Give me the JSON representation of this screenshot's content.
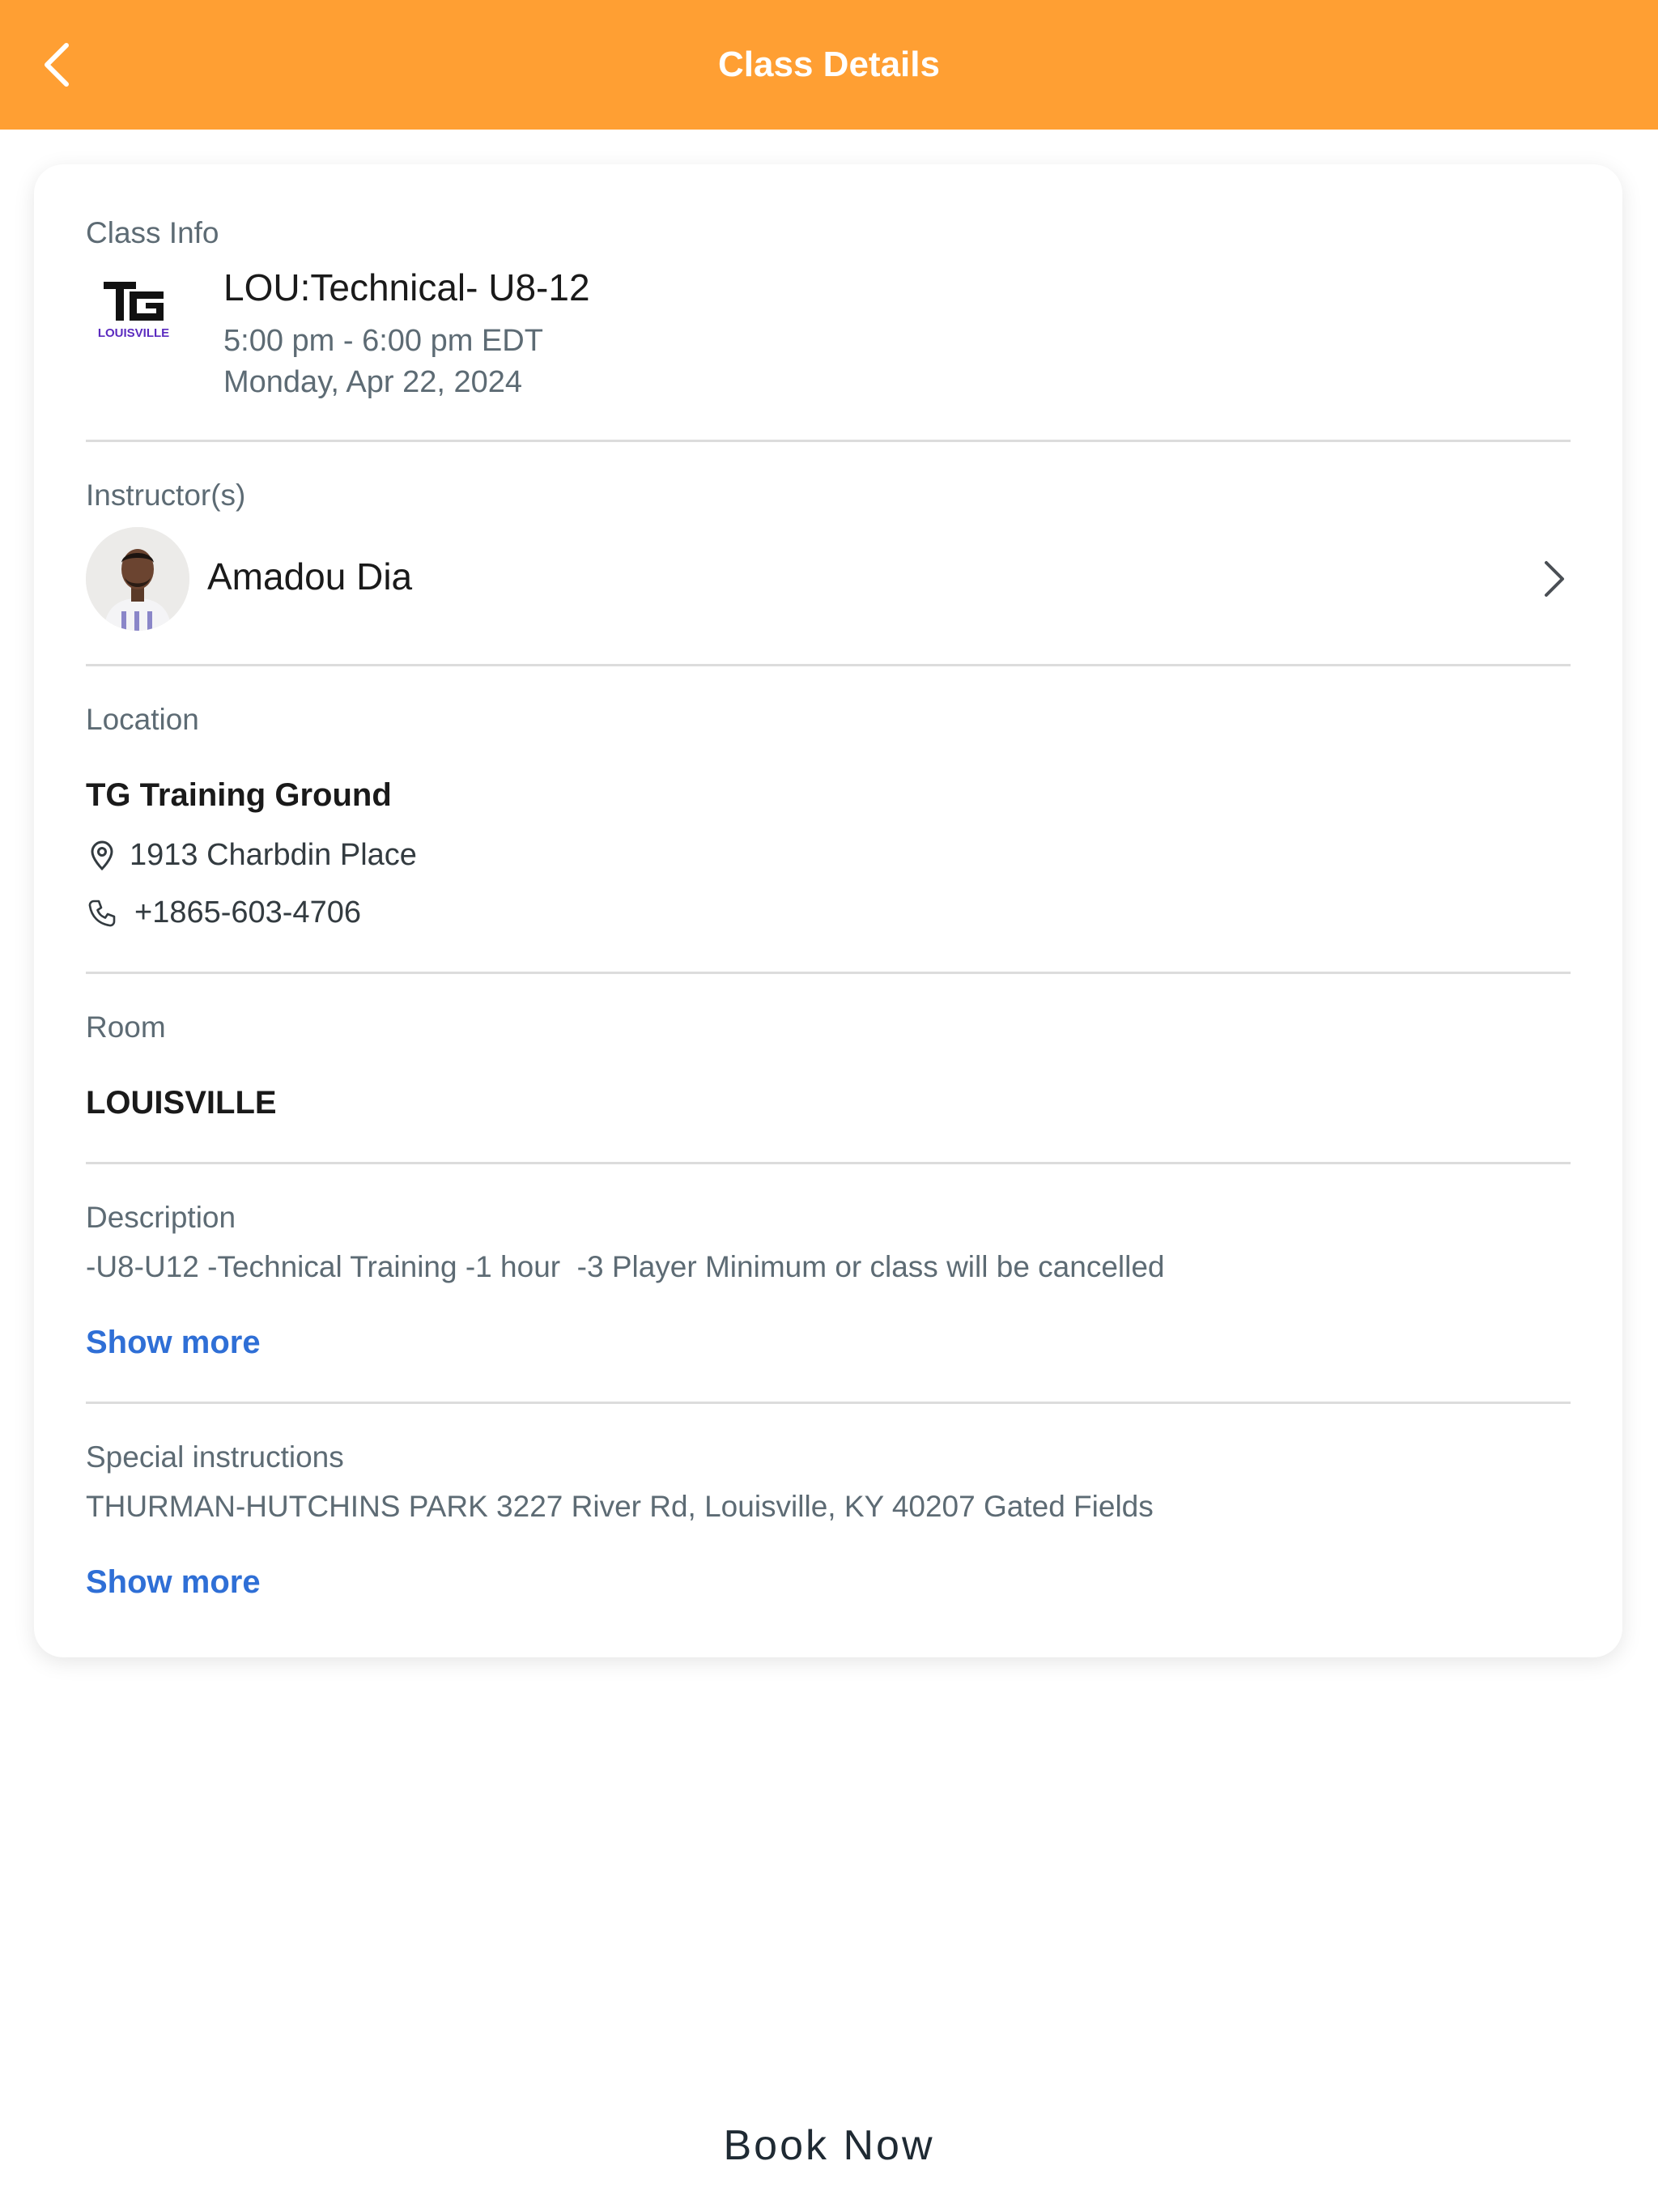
{
  "header": {
    "title": "Class Details",
    "back_icon": "chevron-left-icon",
    "background": "#ff9f33"
  },
  "class_info": {
    "label": "Class Info",
    "logo": {
      "mark": "TG",
      "caption": "LOUISVILLE"
    },
    "title": "LOU:Technical- U8-12",
    "time": "5:00 pm - 6:00 pm EDT",
    "date": "Monday, Apr 22, 2024"
  },
  "instructors": {
    "label": "Instructor(s)",
    "items": [
      {
        "name": "Amadou Dia"
      }
    ]
  },
  "location": {
    "label": "Location",
    "name": "TG Training Ground",
    "address": "1913 Charbdin Place",
    "phone": "+1865-603-4706"
  },
  "room": {
    "label": "Room",
    "name": "LOUISVILLE"
  },
  "description": {
    "label": "Description",
    "text": "-U8-U12 -Technical Training -1 hour  -3 Player Minimum or class will be cancelled",
    "show_more": "Show more"
  },
  "special_instructions": {
    "label": "Special instructions",
    "text": "THURMAN-HUTCHINS PARK 3227 River Rd, Louisville, KY 40207 Gated Fields",
    "show_more": "Show more"
  },
  "footer": {
    "book_now": "Book Now"
  },
  "colors": {
    "accent": "#ff9f33",
    "link": "#2f6fd6",
    "muted_text": "#5d6b74",
    "logo_purple": "#5b2bbf"
  }
}
